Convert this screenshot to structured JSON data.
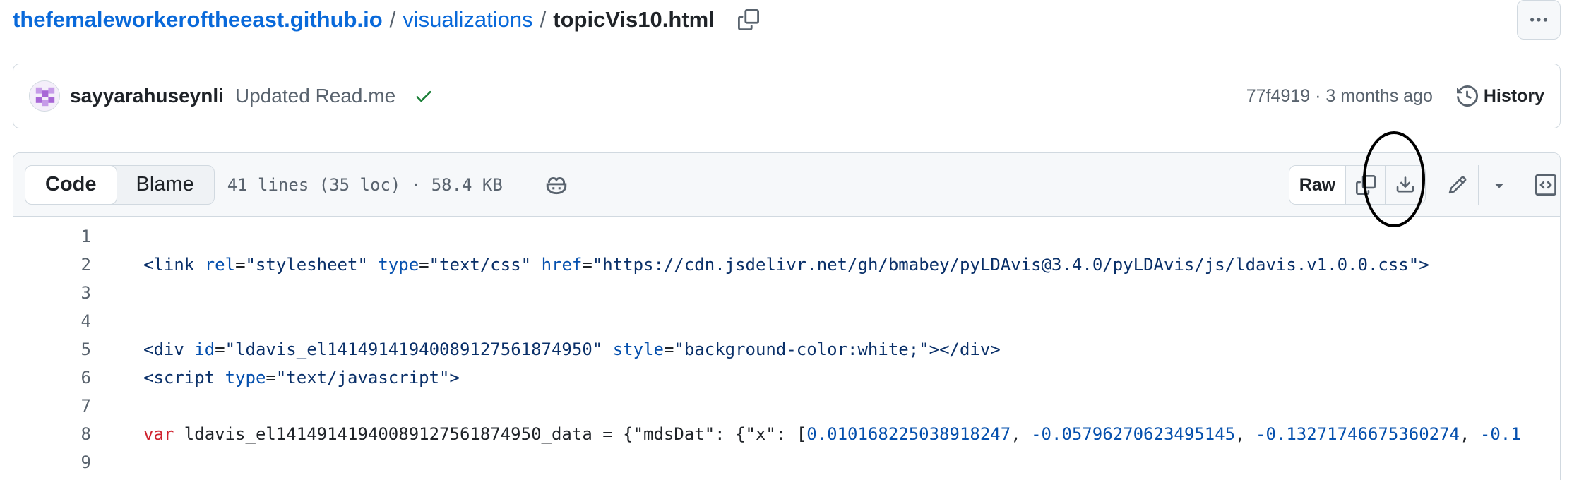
{
  "breadcrumb": {
    "repo": "thefemaleworkeroftheeast.github.io",
    "sep1": "/",
    "folder": "visualizations",
    "sep2": "/",
    "file": "topicVis10.html"
  },
  "commit": {
    "author": "sayyarahuseynli",
    "message": "Updated Read.me",
    "meta": "77f4919 · 3 months ago",
    "history_label": "History"
  },
  "file_header": {
    "tab_code": "Code",
    "tab_blame": "Blame",
    "stats": "41 lines (35 loc) · 58.4 KB",
    "raw_label": "Raw"
  },
  "colors": {
    "link": "#0969da",
    "success": "#1a7f37",
    "annotation": "#000000"
  },
  "icons": [
    "copy-icon",
    "kebab-icon",
    "check-icon",
    "history-icon",
    "copilot-icon",
    "download-icon",
    "pencil-icon",
    "triangle-down-icon",
    "code-square-icon"
  ],
  "code": {
    "lines": [
      {
        "n": "1"
      },
      {
        "n": "2",
        "t1": "<link ",
        "a1": "rel",
        "e1": "=",
        "s1": "\"stylesheet\"",
        "sp1": " ",
        "a2": "type",
        "e2": "=",
        "s2": "\"text/css\"",
        "sp2": " ",
        "a3": "href",
        "e3": "=",
        "s3": "\"https://cdn.jsdelivr.net/gh/bmabey/pyLDAvis@3.4.0/pyLDAvis/js/ldavis.v1.0.0.css\"",
        "end": ">"
      },
      {
        "n": "3"
      },
      {
        "n": "4"
      },
      {
        "n": "5",
        "t1": "<div ",
        "a1": "id",
        "e1": "=",
        "s1": "\"ldavis_el14149141940089127561874950\"",
        "sp1": " ",
        "a2": "style",
        "e2": "=",
        "s2": "\"background-color:white;\"",
        "close": "></div>"
      },
      {
        "n": "6",
        "t1": "<script ",
        "a1": "type",
        "e1": "=",
        "s1": "\"text/javascript\"",
        "end": ">"
      },
      {
        "n": "7"
      },
      {
        "n": "8",
        "kw": "var",
        "rest": " ldavis_el14149141940089127561874950_data = {\"mdsDat\": {\"x\": [",
        "n1": "0.010168225038918247",
        "c1": ", ",
        "n2": "-0.05796270623495145",
        "c2": ", ",
        "n3": "-0.13271746675360274",
        "c3": ", ",
        "n4": "-0.1"
      },
      {
        "n": "9"
      }
    ]
  }
}
